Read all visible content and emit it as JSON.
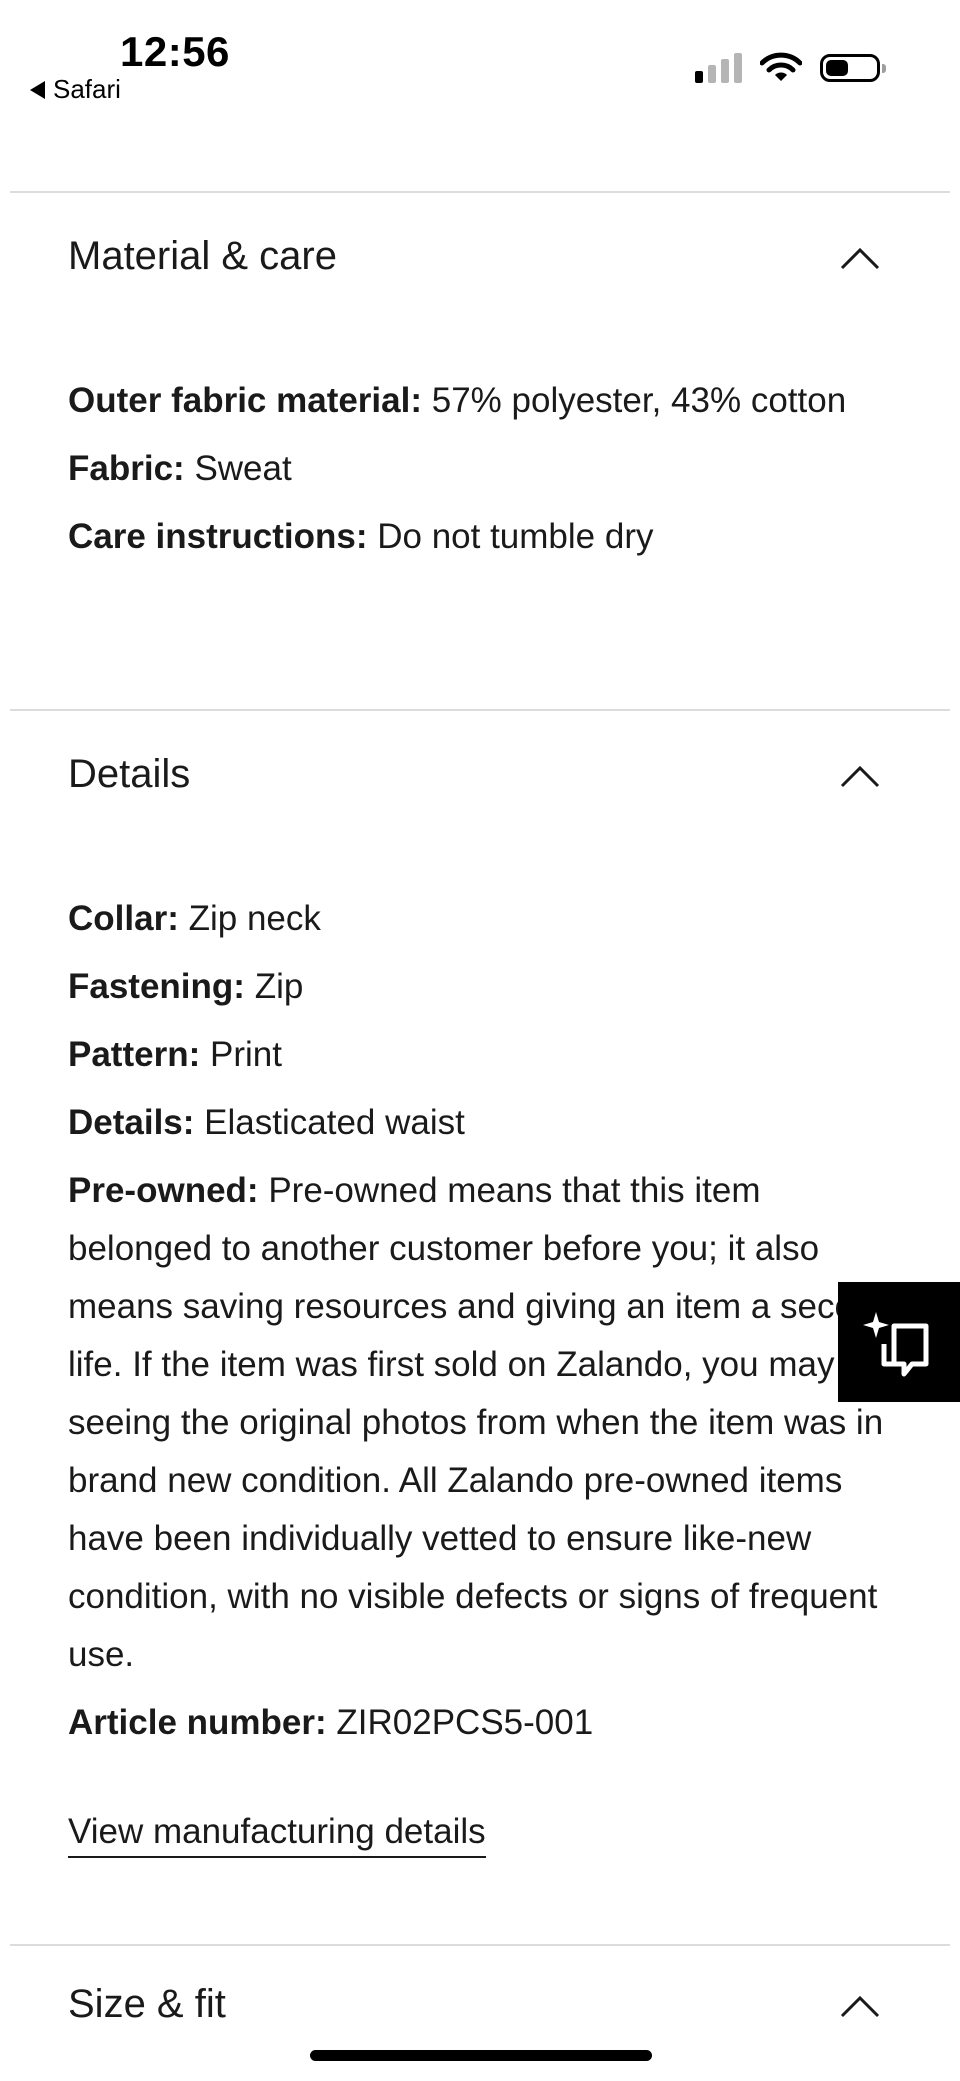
{
  "status_bar": {
    "time": "12:56",
    "back_app": "Safari",
    "signal_bars_active": 1,
    "signal_bars_total": 4,
    "battery_level": 0.45
  },
  "sections": {
    "material": {
      "title": "Material & care",
      "rows": [
        {
          "label": "Outer fabric material:",
          "value": "57% polyester, 43% cotton"
        },
        {
          "label": "Fabric:",
          "value": "Sweat"
        },
        {
          "label": "Care instructions:",
          "value": "Do not tumble dry"
        }
      ]
    },
    "details": {
      "title": "Details",
      "rows": [
        {
          "label": "Collar:",
          "value": "Zip neck"
        },
        {
          "label": "Fastening:",
          "value": "Zip"
        },
        {
          "label": "Pattern:",
          "value": "Print"
        },
        {
          "label": "Details:",
          "value": "Elasticated waist"
        },
        {
          "label": "Pre-owned:",
          "value": "Pre-owned means that this item belonged to another customer before you; it also means saving resources and giving an item a second life. If the item was first sold on Zalando, you may be seeing the original photos from when the item was in brand new condition. All Zalando pre-owned items have been individually vetted to ensure like-new condition, with no visible defects or signs of frequent use."
        },
        {
          "label": "Article number:",
          "value": "ZIR02PCS5-001"
        }
      ],
      "link": "View manufacturing details"
    },
    "size_fit": {
      "title": "Size & fit"
    }
  },
  "icons": {
    "back": "back-triangle-icon",
    "signal": "cellular-signal-icon",
    "wifi": "wifi-icon",
    "battery": "battery-icon",
    "chevron": "chevron-up-icon",
    "feedback": "sparkle-chat-icon"
  },
  "colors": {
    "text": "#1a1a1a",
    "divider": "#dcdcdc",
    "signal_active": "#000000",
    "signal_inactive": "#b5b5b5",
    "float_button": "#000000"
  }
}
